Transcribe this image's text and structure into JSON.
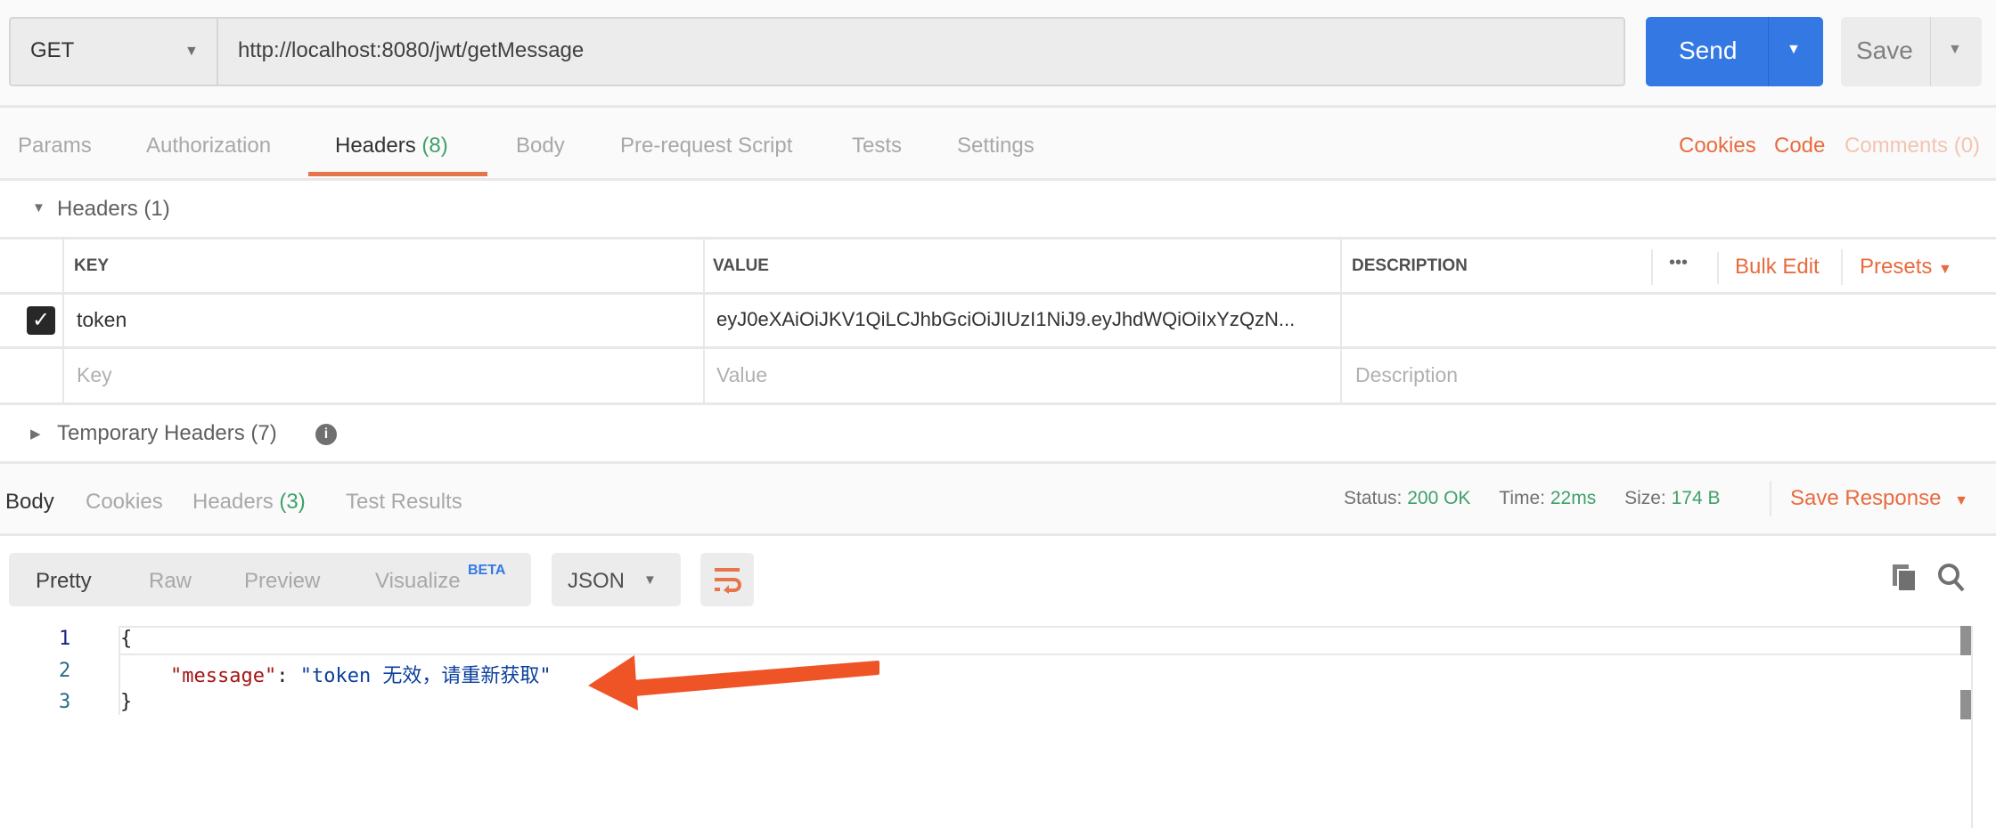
{
  "request": {
    "method": "GET",
    "url": "http://localhost:8080/jwt/getMessage",
    "send_label": "Send",
    "save_label": "Save"
  },
  "request_tabs": [
    {
      "label": "Params"
    },
    {
      "label": "Authorization"
    },
    {
      "label": "Headers",
      "count": "(8)"
    },
    {
      "label": "Body"
    },
    {
      "label": "Pre-request Script"
    },
    {
      "label": "Tests"
    },
    {
      "label": "Settings"
    }
  ],
  "request_links": {
    "cookies": "Cookies",
    "code": "Code",
    "comments": "Comments (0)"
  },
  "headers_section": {
    "title": "Headers",
    "count": "(1)"
  },
  "headers_table": {
    "columns": {
      "key": "KEY",
      "value": "VALUE",
      "description": "DESCRIPTION"
    },
    "more": "•••",
    "bulk_edit": "Bulk Edit",
    "presets": "Presets",
    "rows": [
      {
        "checked": true,
        "key": "token",
        "value": "eyJ0eXAiOiJKV1QiLCJhbGciOiJIUzI1NiJ9.eyJhdWQiOiIxYzQzN...",
        "description": ""
      }
    ],
    "placeholders": {
      "key": "Key",
      "value": "Value",
      "description": "Description"
    }
  },
  "temporary_headers": {
    "title": "Temporary Headers",
    "count": "(7)"
  },
  "response_tabs": [
    {
      "label": "Body"
    },
    {
      "label": "Cookies"
    },
    {
      "label": "Headers",
      "count": "(3)"
    },
    {
      "label": "Test Results"
    }
  ],
  "response_meta": {
    "status_label": "Status:",
    "status": "200 OK",
    "time_label": "Time:",
    "time": "22ms",
    "size_label": "Size:",
    "size": "174 B",
    "save_response": "Save Response"
  },
  "view_modes": {
    "pretty": "Pretty",
    "raw": "Raw",
    "preview": "Preview",
    "visualize": "Visualize",
    "beta": "BETA",
    "format": "JSON"
  },
  "code": {
    "lines": [
      "1",
      "2",
      "3"
    ],
    "open": "{",
    "key": "\"message\"",
    "colon": ": ",
    "value": "\"token 无效，请重新获取\"",
    "close": "}"
  },
  "colors": {
    "accent": "#e86b3f",
    "send": "#3479e3",
    "green": "#3fa06a"
  }
}
